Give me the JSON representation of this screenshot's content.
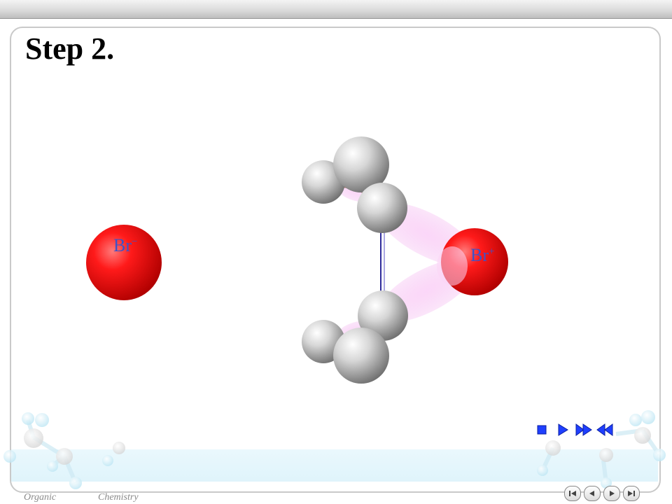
{
  "slide": {
    "title": "Step 2."
  },
  "molecule": {
    "bromide_label": "Br",
    "bromide_charge": "−",
    "bromonium_label": "Br",
    "bromonium_charge": "+"
  },
  "footer": {
    "left": "Organic",
    "right": "Chemistry"
  },
  "controls": {
    "stop_icon": "stop-icon",
    "play_icon": "play-icon",
    "fast_forward_icon": "fast-forward-icon",
    "rewind_icon": "rewind-icon"
  },
  "navigation": [
    "first-slide-icon",
    "previous-slide-icon",
    "next-slide-icon",
    "last-slide-icon"
  ],
  "colors": {
    "bromine": "#ff0000",
    "label": "#3e52c8",
    "controls": "#1f3fff"
  }
}
